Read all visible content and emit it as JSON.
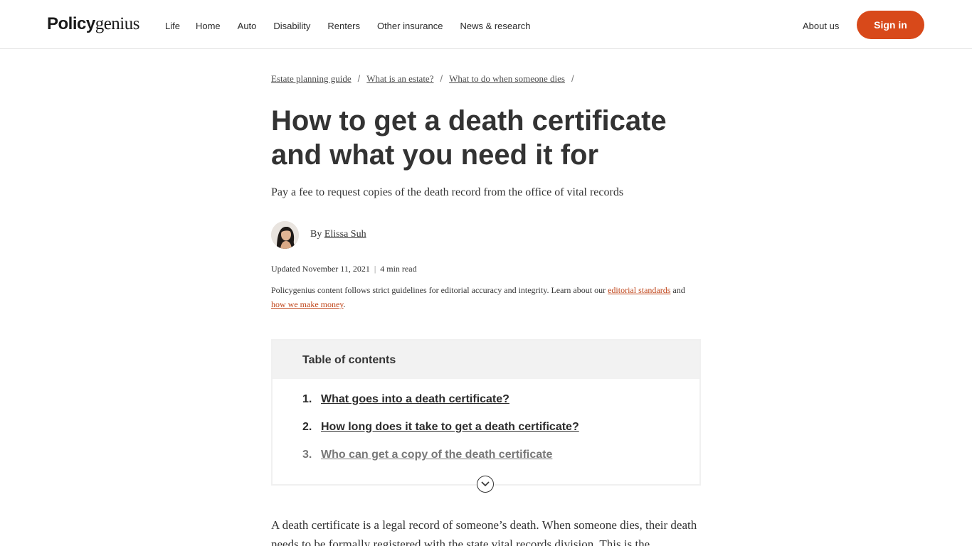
{
  "header": {
    "logo_bold": "Policy",
    "logo_regular": "genius",
    "nav": [
      "Life",
      "Home",
      "Auto",
      "Disability",
      "Renters",
      "Other insurance",
      "News & research"
    ],
    "about": "About us",
    "signin": "Sign in"
  },
  "breadcrumb": [
    "Estate planning guide",
    "What is an estate?",
    "What to do when someone dies"
  ],
  "article": {
    "title": "How to get a death certificate and what you need it for",
    "subtitle": "Pay a fee to request copies of the death record from the office of vital records",
    "by": "By",
    "author": "Elissa Suh",
    "updated": "Updated November 11, 2021",
    "read_time": "4 min read",
    "guidelines_text": "Policygenius content follows strict guidelines for editorial accuracy and integrity. Learn about our",
    "link_editorial": "editorial standards",
    "and": "and",
    "link_money": "how we make money",
    "period": ".",
    "body": "A death certificate is a legal record of someone’s death. When someone dies, their death needs to be formally registered with the state vital records division. This is the"
  },
  "toc": {
    "title": "Table of contents",
    "items": [
      {
        "num": "1.",
        "label": "What goes into a death certificate?"
      },
      {
        "num": "2.",
        "label": "How long does it take to get a death certificate?"
      },
      {
        "num": "3.",
        "label": "Who can get a copy of the death certificate"
      }
    ]
  },
  "colors": {
    "accent": "#d8491a",
    "link": "#c0461b",
    "toc_bg": "#f2f2f2"
  }
}
